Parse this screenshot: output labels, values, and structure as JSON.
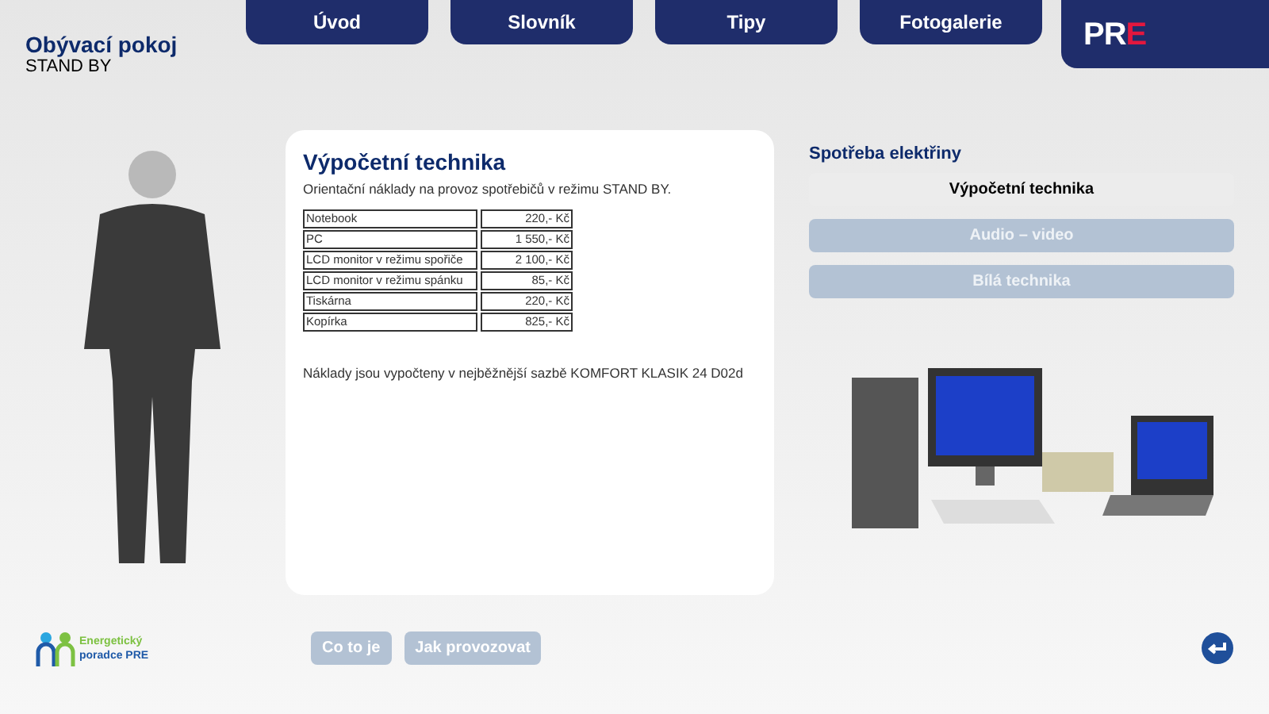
{
  "header": {
    "title": "Obývací pokoj",
    "subtitle": "STAND BY"
  },
  "nav": [
    {
      "label": "Úvod",
      "selected": false
    },
    {
      "label": "Slovník",
      "selected": false
    },
    {
      "label": "Tipy",
      "selected": false
    },
    {
      "label": "Fotogalerie",
      "selected": false
    }
  ],
  "logo": {
    "main": "PR",
    "accent": "E"
  },
  "card": {
    "title": "Výpočetní technika",
    "intro": "Orientační náklady na provoz spotřebičů v režimu STAND BY.",
    "rows": [
      {
        "item": "Notebook",
        "cost": "220,- Kč"
      },
      {
        "item": "PC",
        "cost": "1 550,- Kč"
      },
      {
        "item": "LCD monitor v režimu spořiče",
        "cost": "2 100,- Kč"
      },
      {
        "item": "LCD monitor v režimu spánku",
        "cost": "85,- Kč"
      },
      {
        "item": "Tiskárna",
        "cost": "220,- Kč"
      },
      {
        "item": "Kopírka",
        "cost": "825,- Kč"
      }
    ],
    "note": "Náklady jsou vypočteny v nejběžnější sazbě KOMFORT KLASIK 24 D02d"
  },
  "side": {
    "heading": "Spotřeba elektřiny",
    "categories": [
      {
        "label": "Výpočetní technika",
        "selected": true
      },
      {
        "label": "Audio – video",
        "selected": false
      },
      {
        "label": "Bílá technika",
        "selected": false
      }
    ]
  },
  "footer": {
    "brand_line1": "Energetický",
    "brand_line2": "poradce PRE",
    "buttons": [
      "Co to je",
      "Jak provozovat"
    ]
  }
}
